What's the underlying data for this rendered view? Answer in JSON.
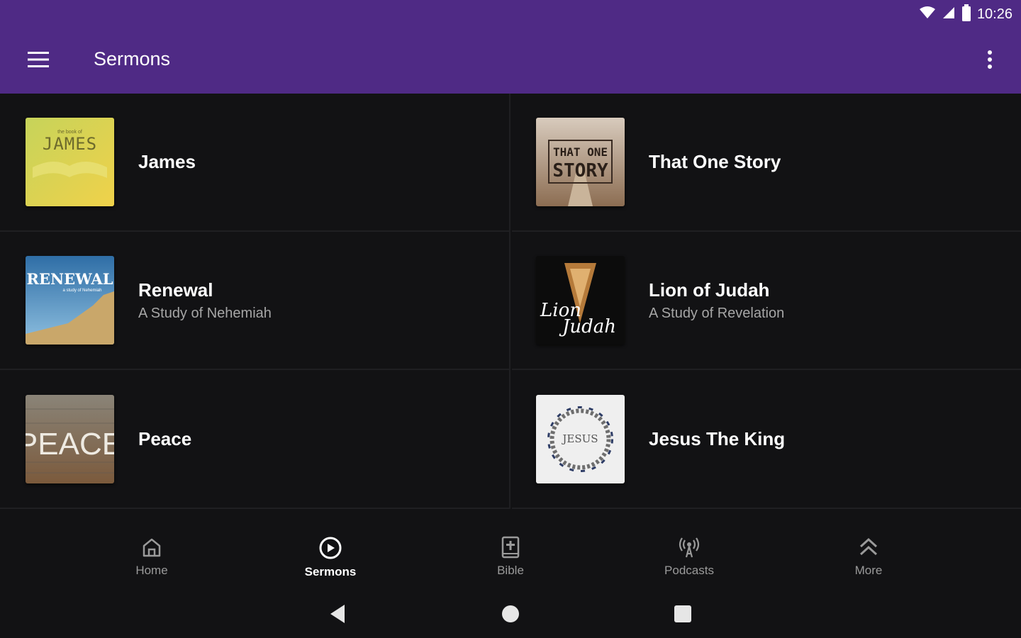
{
  "status": {
    "time": "10:26",
    "icons": [
      "wifi-icon",
      "cell-signal-icon",
      "battery-icon"
    ]
  },
  "appbar": {
    "title": "Sermons",
    "menu_icon": "hamburger-menu-icon",
    "overflow_icon": "more-vert-icon",
    "background": "#4f2a85"
  },
  "sermons": [
    {
      "title": "James",
      "subtitle": "",
      "art": {
        "kicker": "the book of",
        "word": "JAMES"
      }
    },
    {
      "title": "That One Story",
      "subtitle": "",
      "art": {
        "line1": "THAT ONE",
        "line2": "STORY"
      }
    },
    {
      "title": "Renewal",
      "subtitle": "A Study of Nehemiah",
      "art": {
        "word": "RENEWAL",
        "kicker": "a study of Nehemiah"
      }
    },
    {
      "title": "Lion of Judah",
      "subtitle": "A Study of Revelation",
      "art": {
        "line1": "Lion",
        "line2": "Judah"
      }
    },
    {
      "title": "Peace",
      "subtitle": "",
      "art": {
        "word": "PEACE"
      }
    },
    {
      "title": "Jesus The King",
      "subtitle": "",
      "art": {
        "word": "JESUS"
      }
    }
  ],
  "bottom_nav": [
    {
      "label": "Home",
      "icon": "home-icon",
      "active": false
    },
    {
      "label": "Sermons",
      "icon": "play-circle-icon",
      "active": true
    },
    {
      "label": "Bible",
      "icon": "bible-icon",
      "active": false
    },
    {
      "label": "Podcasts",
      "icon": "podcast-icon",
      "active": false
    },
    {
      "label": "More",
      "icon": "chevrons-up-icon",
      "active": false
    }
  ],
  "system_nav": [
    "back-icon",
    "home-circle-icon",
    "recents-icon"
  ]
}
